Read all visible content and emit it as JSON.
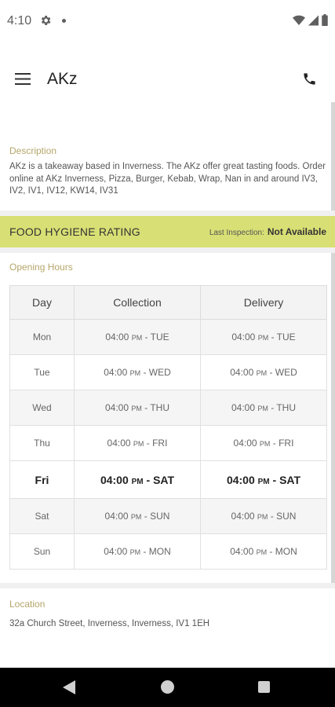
{
  "status_bar": {
    "time": "4:10",
    "icons": [
      "gear-icon",
      "notification-dot",
      "wifi-icon",
      "signal-icon",
      "battery-icon"
    ]
  },
  "app_bar": {
    "title": "AKz",
    "menu_icon": "hamburger-menu-icon",
    "action_icon": "phone-icon"
  },
  "description": {
    "label": "Description",
    "text": "AKz is a takeaway based in Inverness. The AKz offer great tasting foods. Order online at AKz Inverness, Pizza, Burger, Kebab, Wrap, Nan in and around IV3, IV2, IV1, IV12, KW14, IV31"
  },
  "hygiene": {
    "title": "FOOD HYGIENE RATING",
    "inspection_label": "Last Inspection:",
    "inspection_value": "Not Available",
    "color": "#d8df74"
  },
  "opening_hours": {
    "label": "Opening Hours",
    "headers": {
      "day": "Day",
      "collection": "Collection",
      "delivery": "Delivery"
    },
    "rows": [
      {
        "day": "Mon",
        "collection_time": "04:00",
        "collection_pm": "PM",
        "collection_to": "- TUE",
        "delivery_time": "04:00",
        "delivery_pm": "PM",
        "delivery_to": "- TUE"
      },
      {
        "day": "Tue",
        "collection_time": "04:00",
        "collection_pm": "PM",
        "collection_to": "- WED",
        "delivery_time": "04:00",
        "delivery_pm": "PM",
        "delivery_to": "- WED"
      },
      {
        "day": "Wed",
        "collection_time": "04:00",
        "collection_pm": "PM",
        "collection_to": "- THU",
        "delivery_time": "04:00",
        "delivery_pm": "PM",
        "delivery_to": "- THU"
      },
      {
        "day": "Thu",
        "collection_time": "04:00",
        "collection_pm": "PM",
        "collection_to": "- FRI",
        "delivery_time": "04:00",
        "delivery_pm": "PM",
        "delivery_to": "- FRI"
      },
      {
        "day": "Fri",
        "collection_time": "04:00",
        "collection_pm": "PM",
        "collection_to": "- SAT",
        "delivery_time": "04:00",
        "delivery_pm": "PM",
        "delivery_to": "- SAT"
      },
      {
        "day": "Sat",
        "collection_time": "04:00",
        "collection_pm": "PM",
        "collection_to": "- SUN",
        "delivery_time": "04:00",
        "delivery_pm": "PM",
        "delivery_to": "- SUN"
      },
      {
        "day": "Sun",
        "collection_time": "04:00",
        "collection_pm": "PM",
        "collection_to": "- MON",
        "delivery_time": "04:00",
        "delivery_pm": "PM",
        "delivery_to": "- MON"
      }
    ],
    "highlighted_day": "Fri"
  },
  "location": {
    "label": "Location",
    "address": "32a Church Street, Inverness, Inverness, IV1 1EH"
  },
  "nav_bar": {
    "icons": [
      "back-icon",
      "home-icon",
      "recents-icon"
    ]
  },
  "colors": {
    "section_label": "#b5a66a",
    "hygiene_bar": "#d8df74"
  }
}
